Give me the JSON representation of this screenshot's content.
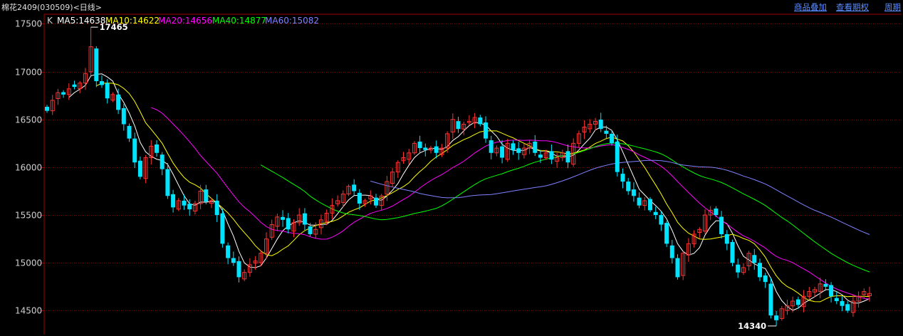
{
  "header": {
    "title": "棉花2409(030509)<日线>",
    "menu": [
      "商品叠加",
      "查看期权",
      "周期"
    ]
  },
  "legend": {
    "k_label": "K",
    "items": [
      {
        "text": "MA5:14638",
        "color": "#ffffff"
      },
      {
        "text": "MA10:14622",
        "color": "#ffff00"
      },
      {
        "text": "MA20:14656",
        "color": "#ff00ff"
      },
      {
        "text": "MA40:14877",
        "color": "#00ff00"
      },
      {
        "text": "MA60:15082",
        "color": "#8080ff"
      }
    ]
  },
  "chart_data": {
    "type": "candlestick",
    "y_ticks": [
      17500,
      17000,
      16500,
      16000,
      15500,
      15000,
      14500
    ],
    "ylim": [
      14250,
      17600
    ],
    "grid": true,
    "colors": {
      "up": "#ff3232",
      "down": "#00e4ff",
      "grid": "#8a0000",
      "axis": "#a00000"
    },
    "annotations": [
      {
        "text": "17465",
        "value": 17465
      },
      {
        "text": "14340",
        "value": 14340
      }
    ],
    "closes": [
      16590,
      16700,
      16780,
      16760,
      16820,
      16840,
      16880,
      16980,
      17260,
      16900,
      16860,
      16720,
      16760,
      16600,
      16450,
      16300,
      16050,
      15900,
      16100,
      16220,
      16150,
      15980,
      15700,
      15580,
      15650,
      15600,
      15560,
      15620,
      15750,
      15640,
      15650,
      15500,
      15200,
      15050,
      15000,
      14850,
      14900,
      14980,
      15020,
      15100,
      15250,
      15400,
      15480,
      15450,
      15350,
      15420,
      15500,
      15400,
      15300,
      15350,
      15450,
      15520,
      15600,
      15650,
      15720,
      15800,
      15750,
      15620,
      15650,
      15700,
      15600,
      15700,
      15850,
      15950,
      16050,
      16100,
      16150,
      16250,
      16200,
      16180,
      16200,
      16150,
      16200,
      16350,
      16500,
      16400,
      16450,
      16480,
      16520,
      16450,
      16300,
      16150,
      16200,
      16100,
      16250,
      16180,
      16150,
      16200,
      16250,
      16150,
      16100,
      16150,
      16080,
      16100,
      16150,
      16050,
      16250,
      16350,
      16420,
      16450,
      16480,
      16400,
      16350,
      16250,
      15950,
      15850,
      15750,
      15700,
      15600,
      15650,
      15550,
      15500,
      15400,
      15200,
      15050,
      14850,
      15100,
      15200,
      15300,
      15350,
      15500,
      15550,
      15500,
      15300,
      15200,
      15000,
      14900,
      14950,
      15100,
      15000,
      14850,
      14800,
      14450,
      14400,
      14520,
      14550,
      14600,
      14560,
      14650,
      14700,
      14720,
      14780,
      14750,
      14650,
      14600,
      14550,
      14500,
      14600,
      14650,
      14700,
      14680
    ],
    "ma": [
      {
        "name": "MA5",
        "color": "#ffffff",
        "start": 4
      },
      {
        "name": "MA10",
        "color": "#ffff00",
        "start": 9
      },
      {
        "name": "MA20",
        "color": "#ff00ff",
        "start": 19
      },
      {
        "name": "MA40",
        "color": "#00ff00",
        "start": 39
      },
      {
        "name": "MA60",
        "color": "#8080ff",
        "start": 59
      }
    ]
  }
}
